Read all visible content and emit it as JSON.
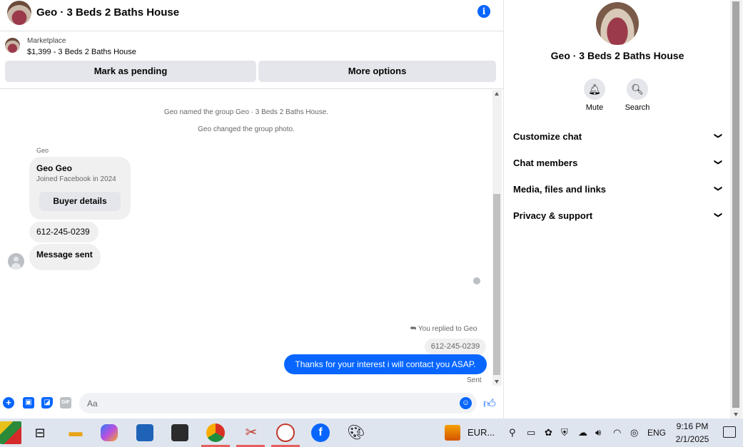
{
  "colors": {
    "accent": "#0866ff",
    "bubble_in": "#f0f0f0",
    "secondary_text": "#65676b"
  },
  "header": {
    "title": "Geo · 3 Beds 2 Baths House"
  },
  "listing": {
    "source": "Marketplace",
    "price_title": "$1,399 - 3 Beds 2 Baths House",
    "mark_pending_label": "Mark as pending",
    "more_options_label": "More options"
  },
  "messages": {
    "system": [
      "Geo named the group Geo · 3 Beds 2 Baths House.",
      "Geo changed the group photo."
    ],
    "sender_name": "Geo",
    "card": {
      "name": "Geo Geo",
      "joined": "Joined Facebook in 2024",
      "buyer_details_label": "Buyer details"
    },
    "phone": "612-245-0239",
    "message_sent": "Message sent",
    "reply_label": "You replied to Geo",
    "reply_quote": "612-245-0239",
    "outgoing": "Thanks for your interest i will contact you ASAP.",
    "status": "Sent"
  },
  "composer": {
    "placeholder": "Aa"
  },
  "info": {
    "title": "Geo · 3 Beds 2 Baths House",
    "mute_label": "Mute",
    "search_label": "Search",
    "sections": [
      "Customize chat",
      "Chat members",
      "Media, files and links",
      "Privacy & support"
    ]
  },
  "taskbar": {
    "eur_label": "EUR...",
    "language": "ENG",
    "time": "9:16 PM",
    "date": "2/1/2025"
  }
}
